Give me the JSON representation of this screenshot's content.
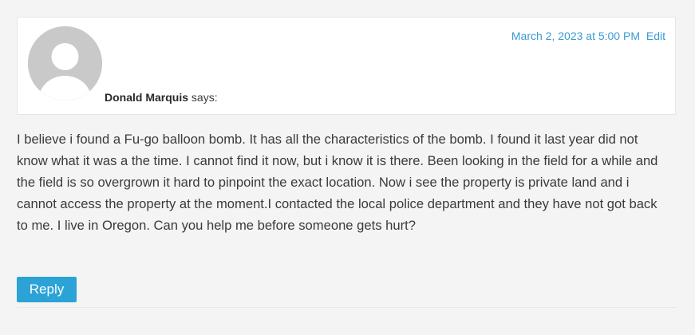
{
  "comment": {
    "date_text": "March 2, 2023 at 5:00 PM",
    "edit_label": "Edit",
    "author_name": "Donald Marquis",
    "says_text": "says:",
    "avatar_icon": "default-user-avatar-icon",
    "body": "I believe i found a Fu-go balloon bomb. It has all the characteristics of the bomb. I found it last year did not know what it was a the time. I cannot find it now, but i know it is there. Been looking in the field for a while and the field is so overgrown it hard to pinpoint the exact location. Now i see the property is private land and i cannot access the property at the moment.I contacted the local police department and they have not got back to me. I live in Oregon. Can you help me before someone gets hurt?",
    "reply_label": "Reply"
  },
  "colors": {
    "page_background": "#f4f4f4",
    "meta_background": "#ffffff",
    "link": "#3c9bd1",
    "reply_button": "#2ba3d6",
    "avatar": "#c9c9c9"
  }
}
